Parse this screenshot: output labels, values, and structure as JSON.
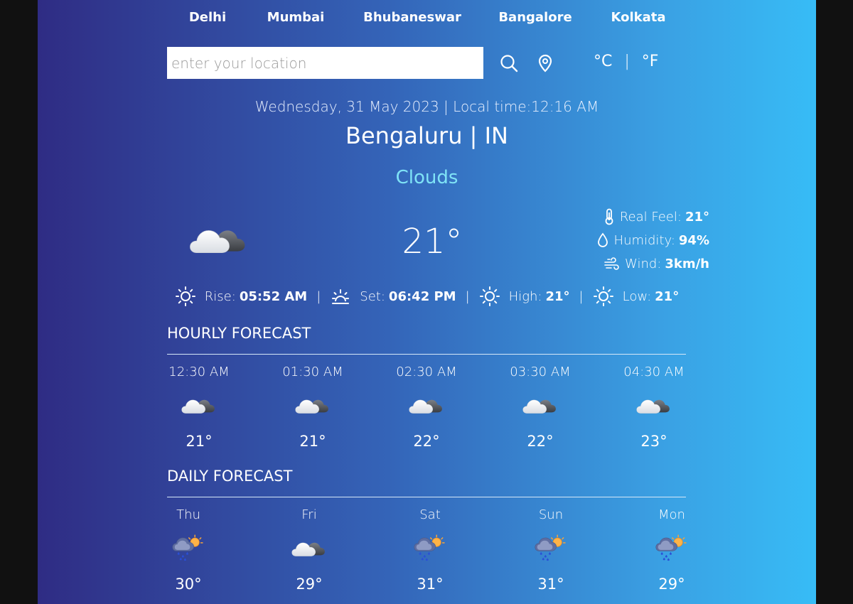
{
  "nav": {
    "cities": [
      "Delhi",
      "Mumbai",
      "Bhubaneswar",
      "Bangalore",
      "Kolkata"
    ]
  },
  "search": {
    "placeholder": "enter your location",
    "value": ""
  },
  "icons": {
    "search": "search-icon",
    "location": "location-pin-icon"
  },
  "units": {
    "celsius": "°C",
    "separator": "|",
    "fahrenheit": "°F"
  },
  "current": {
    "datetime": "Wednesday, 31 May 2023 | Local time:12:16 AM",
    "city": "Bengaluru | IN",
    "condition": "Clouds",
    "temp": "21°",
    "real_feel_label": "Real Feel:",
    "real_feel": "21°",
    "humidity_label": "Humidity:",
    "humidity": "94%",
    "wind_label": "Wind:",
    "wind": "3km/h",
    "rise_label": "Rise:",
    "rise": "05:52 AM",
    "set_label": "Set:",
    "set": "06:42 PM",
    "high_label": "High:",
    "high": "21°",
    "low_label": "Low:",
    "low": "21°",
    "sep": "|"
  },
  "hourly": {
    "title": "HOURLY FORECAST",
    "items": [
      {
        "time": "12:30 AM",
        "icon": "cloud-night-icon",
        "temp": "21°"
      },
      {
        "time": "01:30 AM",
        "icon": "cloud-night-icon",
        "temp": "21°"
      },
      {
        "time": "02:30 AM",
        "icon": "cloud-night-icon",
        "temp": "22°"
      },
      {
        "time": "03:30 AM",
        "icon": "cloud-night-icon",
        "temp": "22°"
      },
      {
        "time": "04:30 AM",
        "icon": "cloud-night-icon",
        "temp": "23°"
      }
    ]
  },
  "daily": {
    "title": "DAILY FORECAST",
    "items": [
      {
        "day": "Thu",
        "icon": "rain-sun-icon",
        "temp": "30°"
      },
      {
        "day": "Fri",
        "icon": "cloud-night-icon",
        "temp": "29°"
      },
      {
        "day": "Sat",
        "icon": "rain-sun-icon",
        "temp": "31°"
      },
      {
        "day": "Sun",
        "icon": "rain-sun-icon",
        "temp": "31°"
      },
      {
        "day": "Mon",
        "icon": "rain-sun-icon",
        "temp": "29°"
      }
    ]
  },
  "colors": {
    "gradient_start": "#2f2c84",
    "gradient_end": "#37bcf6",
    "condition": "#7fe3f6"
  }
}
